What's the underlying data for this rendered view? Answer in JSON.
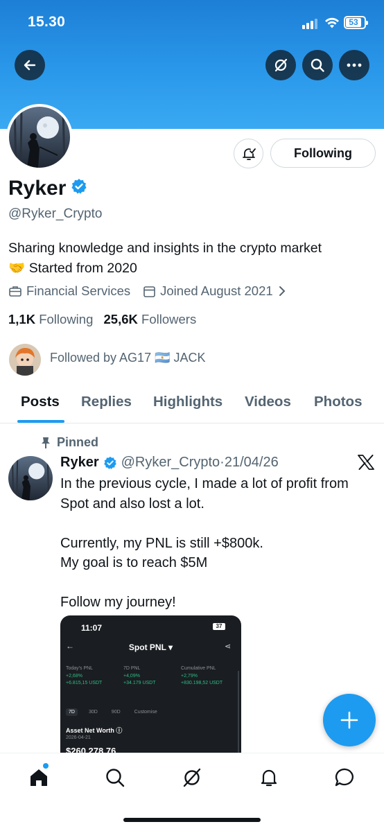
{
  "status_bar": {
    "time": "15.30",
    "battery": "53"
  },
  "header": {
    "back_icon": "arrow-left-icon",
    "grok_icon": "grok-icon",
    "search_icon": "search-icon",
    "more_icon": "more-icon",
    "banner_color": "#2a98ea"
  },
  "profile": {
    "name": "Ryker",
    "handle": "@Ryker_Crypto",
    "bio_line1": "Sharing knowledge and insights in the crypto market",
    "bio_line2": "🤝 Started from 2020",
    "category": "Financial Services",
    "joined": "Joined August 2021",
    "following_count": "1,1K",
    "following_label": "Following",
    "followers_count": "25,6K",
    "followers_label": "Followers",
    "followed_by": "Followed by AG17 🇦🇷 JACK",
    "following_button": "Following"
  },
  "tabs": [
    {
      "label": "Posts",
      "active": true
    },
    {
      "label": "Replies",
      "active": false
    },
    {
      "label": "Highlights",
      "active": false
    },
    {
      "label": "Videos",
      "active": false
    },
    {
      "label": "Photos",
      "active": false
    }
  ],
  "pinned_post": {
    "pinned_label": "Pinned",
    "author_name": "Ryker",
    "author_handle": "@Ryker_Crypto",
    "separator": "·",
    "date": "21/04/26",
    "text_lines": [
      "In the previous cycle, I made a lot of profit from",
      "Spot and also lost a lot.",
      "",
      "Currently, my PNL is still +$800k.",
      "My goal is to reach $5M",
      "",
      "Follow my journey!"
    ],
    "media": {
      "time": "11:07",
      "battery": "37",
      "title": "Spot PNL ▾",
      "columns": [
        {
          "label": "Today's PNL",
          "pct": "+2,68%",
          "amount": "+6.815,15 USDT"
        },
        {
          "label": "7D PNL",
          "pct": "+4,09%",
          "amount": "+34.179 USDT"
        },
        {
          "label": "Cumulative PNL",
          "pct": "+2,79%",
          "amount": "+830.198,52 USDT"
        }
      ],
      "range_tabs": [
        "7D",
        "30D",
        "90D",
        "Customise"
      ],
      "asset_label": "Asset Net Worth ⓘ",
      "asset_date": "2026-04-21",
      "asset_value": "$260.278,76"
    }
  },
  "fab": {
    "icon": "plus-icon",
    "color": "#1d9bf0"
  },
  "bottom_nav": [
    "home-icon",
    "search-icon",
    "grok-icon",
    "notifications-icon",
    "messages-icon"
  ],
  "colors": {
    "accent": "#1d9bf0",
    "text": "#0f1419",
    "muted": "#536471"
  }
}
